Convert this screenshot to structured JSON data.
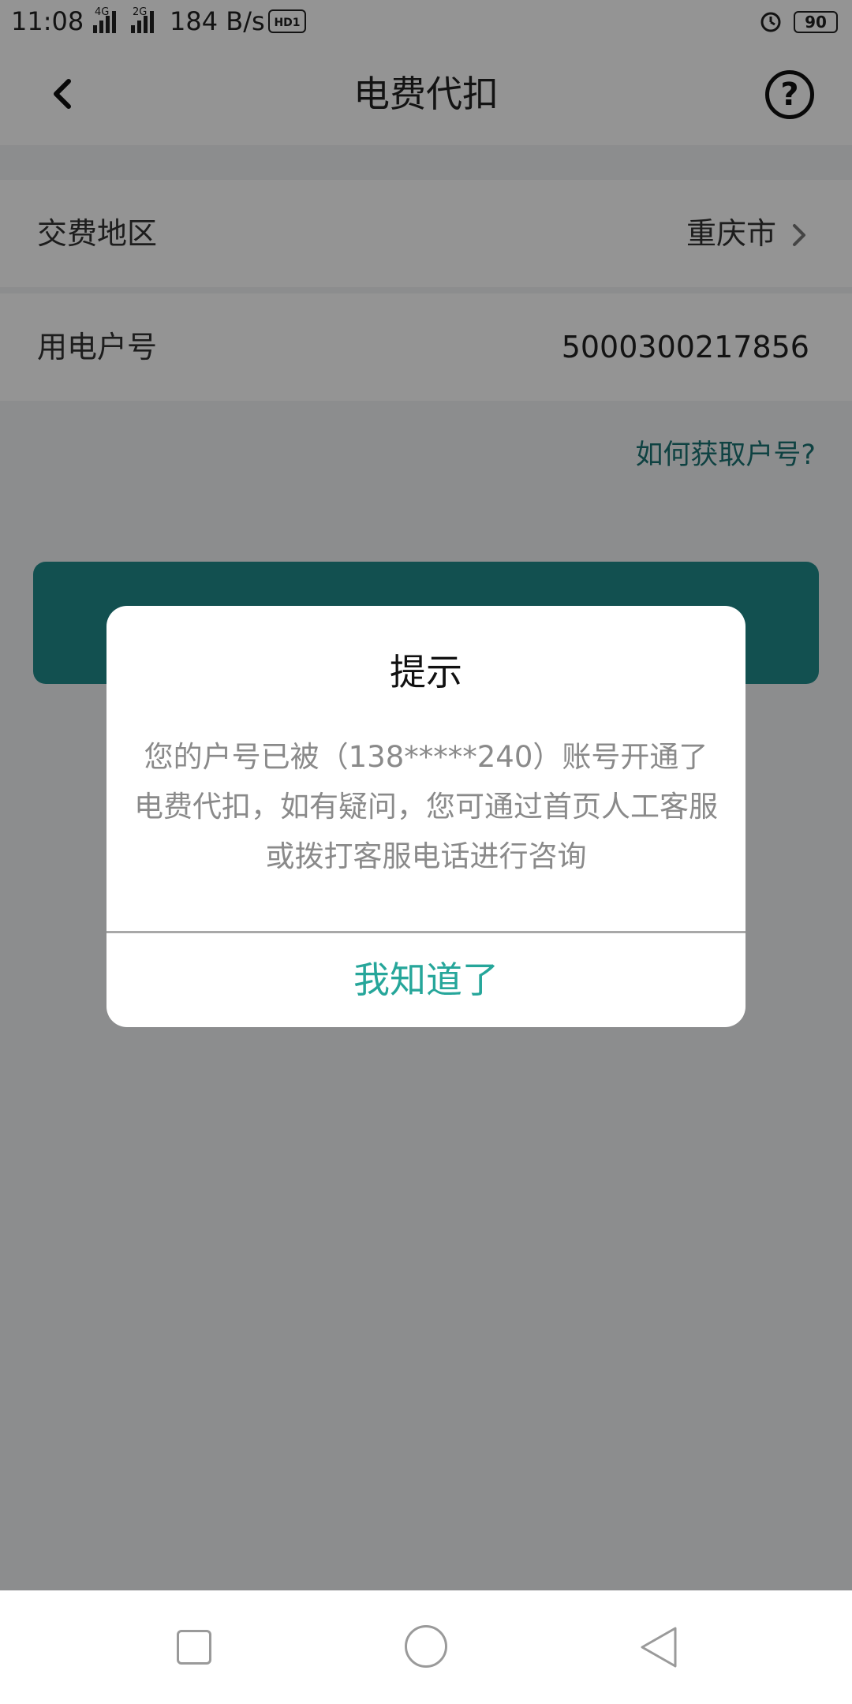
{
  "status_bar": {
    "time": "11:08",
    "signal_1_tag": "4G",
    "signal_2_tag": "2G",
    "speed": "184 B/s",
    "hd_label": "HD1",
    "battery": "90"
  },
  "header": {
    "title": "电费代扣",
    "help_symbol": "?"
  },
  "form": {
    "region_label": "交费地区",
    "region_value": "重庆市",
    "account_label": "用电户号",
    "account_value": "5000300217856"
  },
  "help_link": "如何获取户号?",
  "dialog": {
    "title": "提示",
    "message": "您的户号已被（138*****240）账号开通了电费代扣，如有疑问，您可通过首页人工客服或拨打客服电话进行咨询",
    "confirm_label": "我知道了"
  },
  "colors": {
    "accent": "#26a69a",
    "button": "#1f8a8a",
    "link": "#1a7373"
  }
}
